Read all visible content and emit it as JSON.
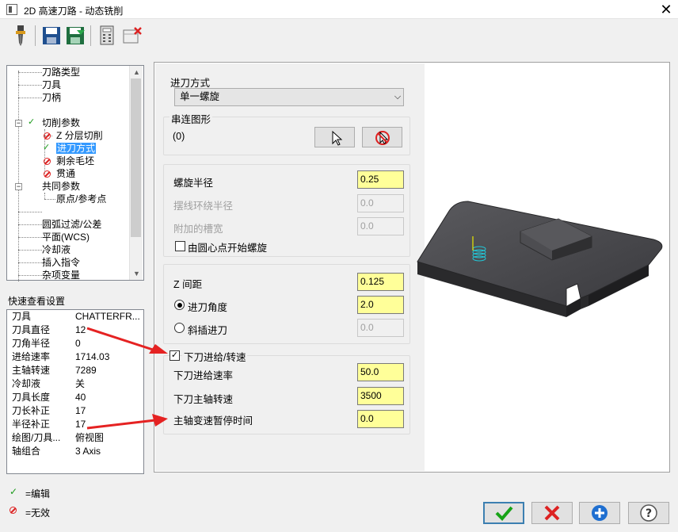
{
  "window": {
    "title": "2D 高速刀路 - 动态铣削",
    "close_glyph": "✕"
  },
  "toolbar": {
    "icons": [
      "tool-icon",
      "save-icon",
      "save-as-icon",
      "calculator-icon",
      "delete-icon"
    ]
  },
  "tree": {
    "items": [
      {
        "label": "刀路类型",
        "status": "",
        "level": 1
      },
      {
        "label": "刀具",
        "status": "",
        "level": 1
      },
      {
        "label": "刀柄",
        "status": "",
        "level": 1
      },
      {
        "label": "切削参数",
        "status": "edited",
        "level": 0,
        "expanded": true
      },
      {
        "label": "Z 分层切削",
        "status": "disabled",
        "level": 2
      },
      {
        "label": "进刀方式",
        "status": "edited",
        "level": 2,
        "selected": true
      },
      {
        "label": "剩余毛坯",
        "status": "disabled",
        "level": 2
      },
      {
        "label": "贯通",
        "status": "disabled",
        "level": 2
      },
      {
        "label": "共同参数",
        "status": "",
        "level": 0,
        "expanded": true
      },
      {
        "label": "原点/参考点",
        "status": "",
        "level": 2
      },
      {
        "label": "圆弧过滤/公差",
        "status": "",
        "level": 1
      },
      {
        "label": "平面(WCS)",
        "status": "",
        "level": 1
      },
      {
        "label": "冷却液",
        "status": "",
        "level": 1
      },
      {
        "label": "插入指令",
        "status": "",
        "level": 1
      },
      {
        "label": "杂项变量",
        "status": "",
        "level": 1
      }
    ]
  },
  "quick_view": {
    "title": "快速查看设置",
    "rows": [
      {
        "key": "刀具",
        "value": "CHATTERFR..."
      },
      {
        "key": "刀具直径",
        "value": "12"
      },
      {
        "key": "刀角半径",
        "value": "0"
      },
      {
        "key": "进给速率",
        "value": "1714.03"
      },
      {
        "key": "主轴转速",
        "value": "7289"
      },
      {
        "key": "冷却液",
        "value": "关"
      },
      {
        "key": "刀具长度",
        "value": "40"
      },
      {
        "key": "刀长补正",
        "value": "17"
      },
      {
        "key": "半径补正",
        "value": "17"
      },
      {
        "key": "绘图/刀具...",
        "value": "俯视图"
      },
      {
        "key": "轴组合",
        "value": "3 Axis"
      }
    ]
  },
  "legend": {
    "edited": "=编辑",
    "invalid": "=无效"
  },
  "entry": {
    "method_label": "进刀方式",
    "method_value": "单一螺旋",
    "chain_label": "串连图形",
    "chain_count": "(0)",
    "helix_radius_label": "螺旋半径",
    "helix_radius": "0.25",
    "trochoid_radius_label": "摆线环绕半径",
    "trochoid_radius": "0.0",
    "extra_slot_label": "附加的槽宽",
    "extra_slot": "0.0",
    "center_start_label": "由圆心点开始螺旋",
    "center_start_checked": false,
    "z_spacing_label": "Z 间距",
    "z_spacing": "0.125",
    "entry_angle_label": "进刀角度",
    "entry_angle": "2.0",
    "ramp_entry_label": "斜插进刀",
    "ramp_entry": "0.0",
    "plunge_feed_group_label": "下刀进给/转速",
    "plunge_feed_checked": true,
    "plunge_feed_rate_label": "下刀进给速率",
    "plunge_feed_rate": "50.0",
    "plunge_spindle_label": "下刀主轴转速",
    "plunge_spindle": "3500",
    "dwell_label": "主轴变速暂停时间",
    "dwell": "0.0"
  },
  "colors": {
    "highlight": "#3399ff",
    "field_yellow": "#ffff99",
    "arrow_red": "#e52222",
    "preview_part": "#3a3a3e"
  }
}
